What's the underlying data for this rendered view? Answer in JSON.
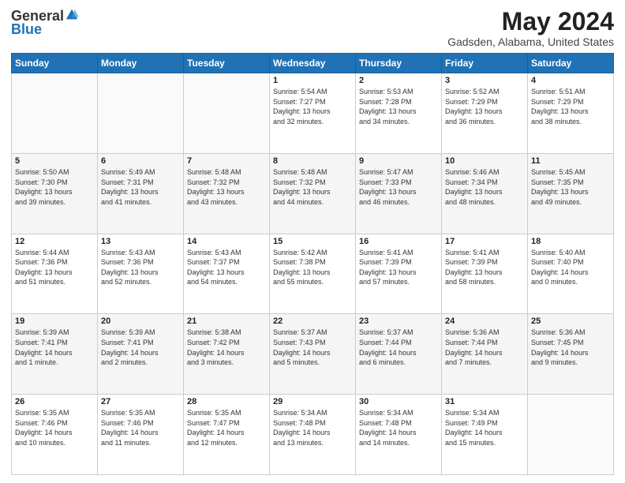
{
  "header": {
    "logo_general": "General",
    "logo_blue": "Blue",
    "month": "May 2024",
    "location": "Gadsden, Alabama, United States"
  },
  "days_of_week": [
    "Sunday",
    "Monday",
    "Tuesday",
    "Wednesday",
    "Thursday",
    "Friday",
    "Saturday"
  ],
  "weeks": [
    [
      {
        "day": "",
        "info": ""
      },
      {
        "day": "",
        "info": ""
      },
      {
        "day": "",
        "info": ""
      },
      {
        "day": "1",
        "info": "Sunrise: 5:54 AM\nSunset: 7:27 PM\nDaylight: 13 hours\nand 32 minutes."
      },
      {
        "day": "2",
        "info": "Sunrise: 5:53 AM\nSunset: 7:28 PM\nDaylight: 13 hours\nand 34 minutes."
      },
      {
        "day": "3",
        "info": "Sunrise: 5:52 AM\nSunset: 7:29 PM\nDaylight: 13 hours\nand 36 minutes."
      },
      {
        "day": "4",
        "info": "Sunrise: 5:51 AM\nSunset: 7:29 PM\nDaylight: 13 hours\nand 38 minutes."
      }
    ],
    [
      {
        "day": "5",
        "info": "Sunrise: 5:50 AM\nSunset: 7:30 PM\nDaylight: 13 hours\nand 39 minutes."
      },
      {
        "day": "6",
        "info": "Sunrise: 5:49 AM\nSunset: 7:31 PM\nDaylight: 13 hours\nand 41 minutes."
      },
      {
        "day": "7",
        "info": "Sunrise: 5:48 AM\nSunset: 7:32 PM\nDaylight: 13 hours\nand 43 minutes."
      },
      {
        "day": "8",
        "info": "Sunrise: 5:48 AM\nSunset: 7:32 PM\nDaylight: 13 hours\nand 44 minutes."
      },
      {
        "day": "9",
        "info": "Sunrise: 5:47 AM\nSunset: 7:33 PM\nDaylight: 13 hours\nand 46 minutes."
      },
      {
        "day": "10",
        "info": "Sunrise: 5:46 AM\nSunset: 7:34 PM\nDaylight: 13 hours\nand 48 minutes."
      },
      {
        "day": "11",
        "info": "Sunrise: 5:45 AM\nSunset: 7:35 PM\nDaylight: 13 hours\nand 49 minutes."
      }
    ],
    [
      {
        "day": "12",
        "info": "Sunrise: 5:44 AM\nSunset: 7:36 PM\nDaylight: 13 hours\nand 51 minutes."
      },
      {
        "day": "13",
        "info": "Sunrise: 5:43 AM\nSunset: 7:36 PM\nDaylight: 13 hours\nand 52 minutes."
      },
      {
        "day": "14",
        "info": "Sunrise: 5:43 AM\nSunset: 7:37 PM\nDaylight: 13 hours\nand 54 minutes."
      },
      {
        "day": "15",
        "info": "Sunrise: 5:42 AM\nSunset: 7:38 PM\nDaylight: 13 hours\nand 55 minutes."
      },
      {
        "day": "16",
        "info": "Sunrise: 5:41 AM\nSunset: 7:39 PM\nDaylight: 13 hours\nand 57 minutes."
      },
      {
        "day": "17",
        "info": "Sunrise: 5:41 AM\nSunset: 7:39 PM\nDaylight: 13 hours\nand 58 minutes."
      },
      {
        "day": "18",
        "info": "Sunrise: 5:40 AM\nSunset: 7:40 PM\nDaylight: 14 hours\nand 0 minutes."
      }
    ],
    [
      {
        "day": "19",
        "info": "Sunrise: 5:39 AM\nSunset: 7:41 PM\nDaylight: 14 hours\nand 1 minute."
      },
      {
        "day": "20",
        "info": "Sunrise: 5:39 AM\nSunset: 7:41 PM\nDaylight: 14 hours\nand 2 minutes."
      },
      {
        "day": "21",
        "info": "Sunrise: 5:38 AM\nSunset: 7:42 PM\nDaylight: 14 hours\nand 3 minutes."
      },
      {
        "day": "22",
        "info": "Sunrise: 5:37 AM\nSunset: 7:43 PM\nDaylight: 14 hours\nand 5 minutes."
      },
      {
        "day": "23",
        "info": "Sunrise: 5:37 AM\nSunset: 7:44 PM\nDaylight: 14 hours\nand 6 minutes."
      },
      {
        "day": "24",
        "info": "Sunrise: 5:36 AM\nSunset: 7:44 PM\nDaylight: 14 hours\nand 7 minutes."
      },
      {
        "day": "25",
        "info": "Sunrise: 5:36 AM\nSunset: 7:45 PM\nDaylight: 14 hours\nand 9 minutes."
      }
    ],
    [
      {
        "day": "26",
        "info": "Sunrise: 5:35 AM\nSunset: 7:46 PM\nDaylight: 14 hours\nand 10 minutes."
      },
      {
        "day": "27",
        "info": "Sunrise: 5:35 AM\nSunset: 7:46 PM\nDaylight: 14 hours\nand 11 minutes."
      },
      {
        "day": "28",
        "info": "Sunrise: 5:35 AM\nSunset: 7:47 PM\nDaylight: 14 hours\nand 12 minutes."
      },
      {
        "day": "29",
        "info": "Sunrise: 5:34 AM\nSunset: 7:48 PM\nDaylight: 14 hours\nand 13 minutes."
      },
      {
        "day": "30",
        "info": "Sunrise: 5:34 AM\nSunset: 7:48 PM\nDaylight: 14 hours\nand 14 minutes."
      },
      {
        "day": "31",
        "info": "Sunrise: 5:34 AM\nSunset: 7:49 PM\nDaylight: 14 hours\nand 15 minutes."
      },
      {
        "day": "",
        "info": ""
      }
    ]
  ]
}
